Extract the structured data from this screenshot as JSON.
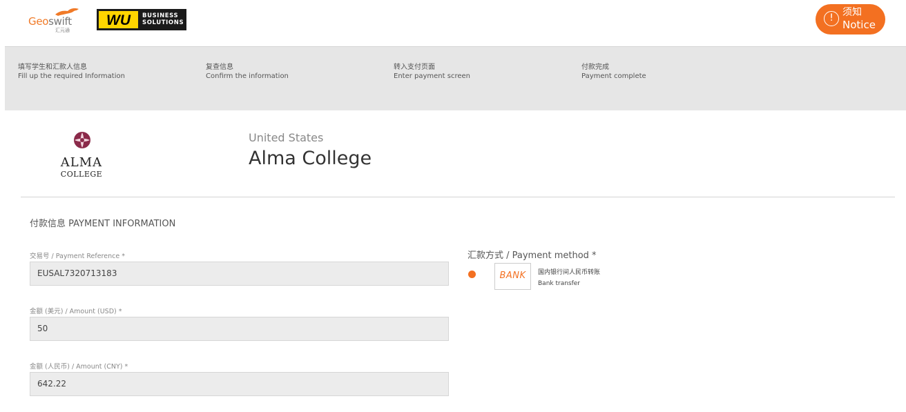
{
  "header": {
    "geoswift_logo": {
      "word_a": "Geo",
      "word_b": "swift",
      "chinese": "汇元通"
    },
    "wu_logo": {
      "mark": "WU",
      "line1": "BUSINESS",
      "line2": "SOLUTIONS"
    },
    "notice": {
      "icon": "info-icon",
      "cn": "须知",
      "en": "Notice",
      "color": "#f37021"
    }
  },
  "steps": [
    {
      "cn": "填写学生和汇款人信息",
      "en": "Fill up the required Information"
    },
    {
      "cn": "复查信息",
      "en": "Confirm the information"
    },
    {
      "cn": "转入支付页面",
      "en": "Enter payment screen"
    },
    {
      "cn": "付款完成",
      "en": "Payment complete"
    }
  ],
  "school": {
    "logo_name": "ALMA",
    "logo_sub": "COLLEGE",
    "country": "United States",
    "name": "Alma College"
  },
  "payment": {
    "title": "付款信息 PAYMENT INFORMATION",
    "fields": [
      {
        "label": "交易号 / Payment Reference *",
        "value": "EUSAL7320713183"
      },
      {
        "label": "金额 (美元) / Amount (USD) *",
        "value": "50"
      },
      {
        "label": "金额 (人民币) / Amount (CNY) *",
        "value": "642.22"
      }
    ],
    "method": {
      "label": "汇款方式 / Payment method *",
      "option_badge": "BANK",
      "option_cn": "国内银行间人民币转账",
      "option_en": "Bank transfer",
      "accent": "#f37021"
    }
  }
}
